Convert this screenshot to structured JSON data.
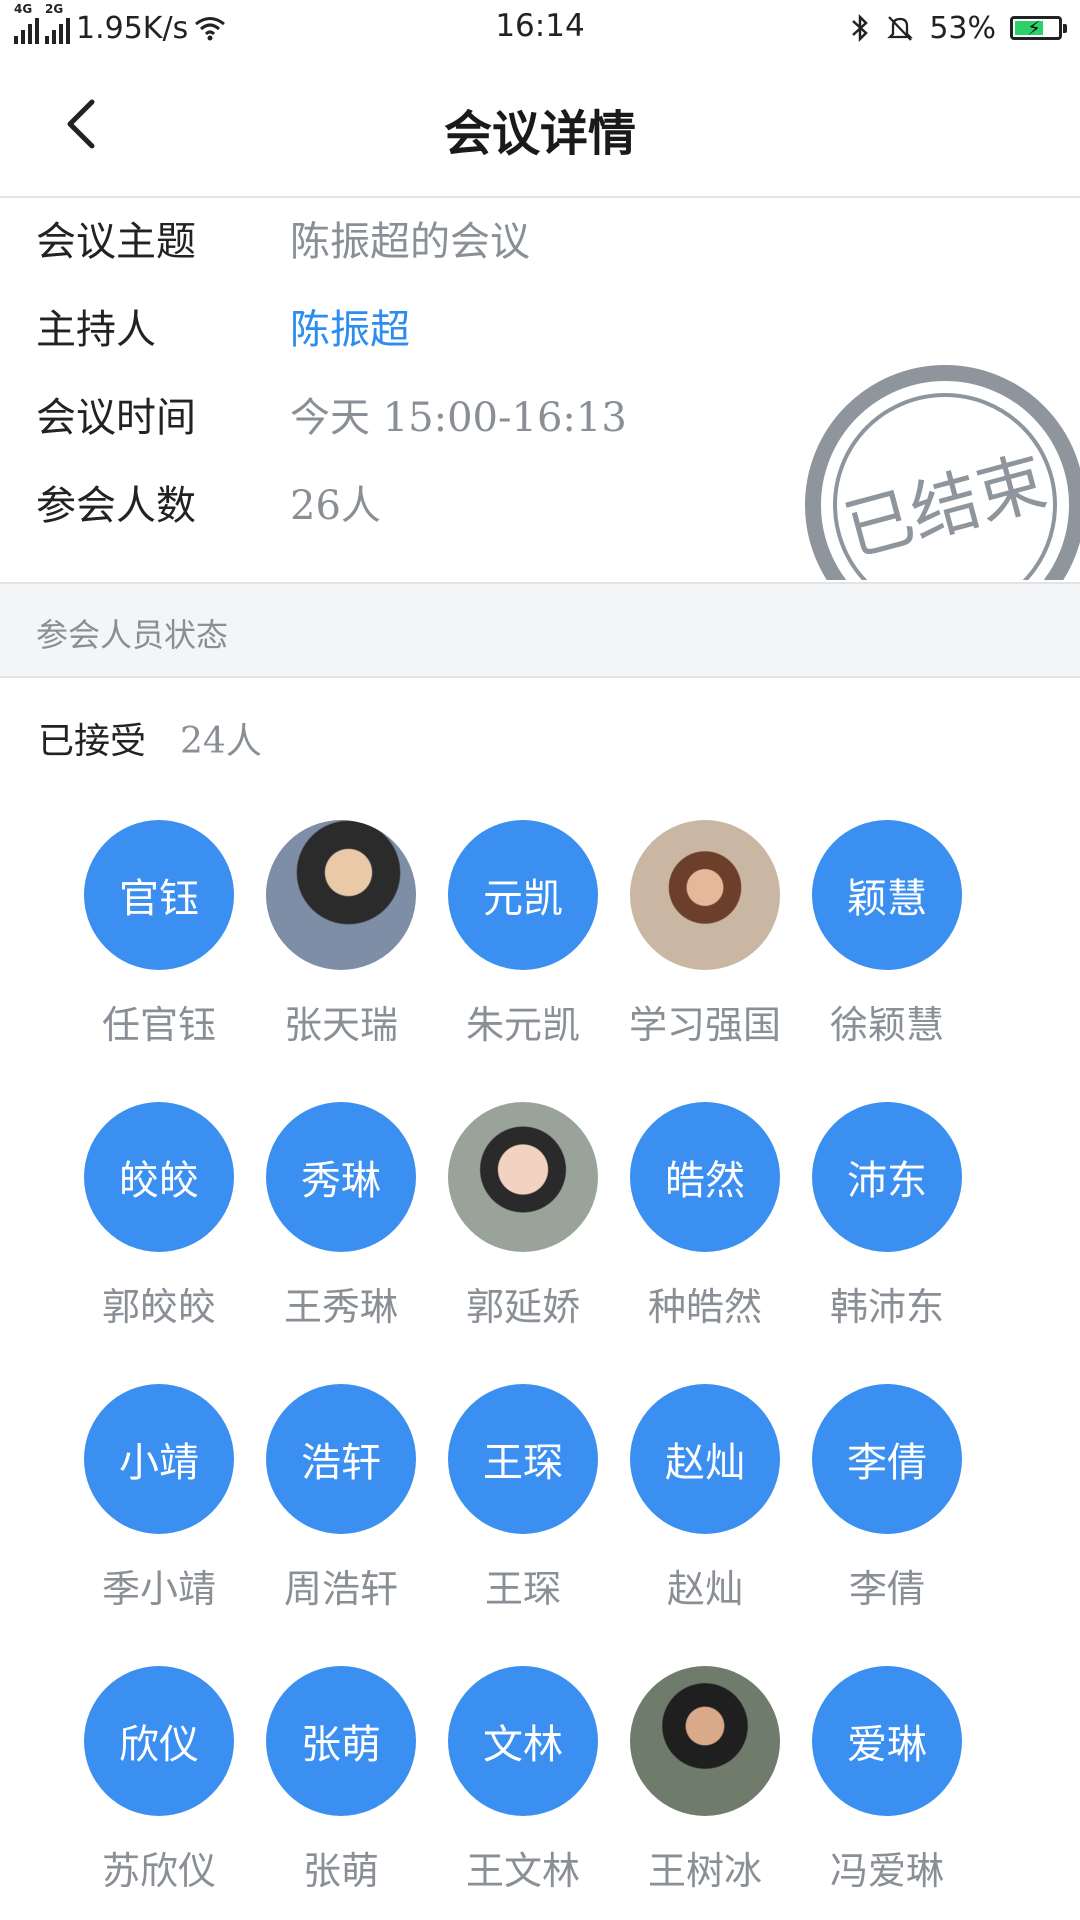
{
  "status_bar": {
    "network1": "4G",
    "network2": "2G",
    "speed": "1.95K/s",
    "time": "16:14",
    "battery": "53%"
  },
  "header": {
    "title": "会议详情"
  },
  "info": {
    "topic_label": "会议主题",
    "topic_value": "陈振超的会议",
    "host_label": "主持人",
    "host_value": "陈振超",
    "time_label": "会议时间",
    "time_value": "今天 15:00-16:13",
    "count_label": "参会人数",
    "count_value": "26人"
  },
  "stamp_text": "已结束",
  "section": {
    "title": "参会人员状态"
  },
  "accepted": {
    "label": "已接受",
    "count": "24人"
  },
  "participants": [
    {
      "name": "任官钰",
      "avatar_text": "官钰",
      "photo": false
    },
    {
      "name": "张天瑞",
      "avatar_text": "",
      "photo": true
    },
    {
      "name": "朱元凯",
      "avatar_text": "元凯",
      "photo": false
    },
    {
      "name": "学习强国",
      "avatar_text": "",
      "photo": true
    },
    {
      "name": "徐颖慧",
      "avatar_text": "颖慧",
      "photo": false
    },
    {
      "name": "郭皎皎",
      "avatar_text": "皎皎",
      "photo": false
    },
    {
      "name": "王秀琳",
      "avatar_text": "秀琳",
      "photo": false
    },
    {
      "name": "郭延娇",
      "avatar_text": "",
      "photo": true
    },
    {
      "name": "种皓然",
      "avatar_text": "皓然",
      "photo": false
    },
    {
      "name": "韩沛东",
      "avatar_text": "沛东",
      "photo": false
    },
    {
      "name": "季小靖",
      "avatar_text": "小靖",
      "photo": false
    },
    {
      "name": "周浩轩",
      "avatar_text": "浩轩",
      "photo": false
    },
    {
      "name": "王琛",
      "avatar_text": "王琛",
      "photo": false
    },
    {
      "name": "赵灿",
      "avatar_text": "赵灿",
      "photo": false
    },
    {
      "name": "李倩",
      "avatar_text": "李倩",
      "photo": false
    },
    {
      "name": "苏欣仪",
      "avatar_text": "欣仪",
      "photo": false
    },
    {
      "name": "张萌",
      "avatar_text": "张萌",
      "photo": false
    },
    {
      "name": "王文林",
      "avatar_text": "文林",
      "photo": false
    },
    {
      "name": "王树冰",
      "avatar_text": "",
      "photo": true
    },
    {
      "name": "冯爱琳",
      "avatar_text": "爱琳",
      "photo": false
    }
  ],
  "colors": {
    "accent": "#3b8ff0",
    "link": "#2d8cf0",
    "muted": "#8a8f96"
  }
}
